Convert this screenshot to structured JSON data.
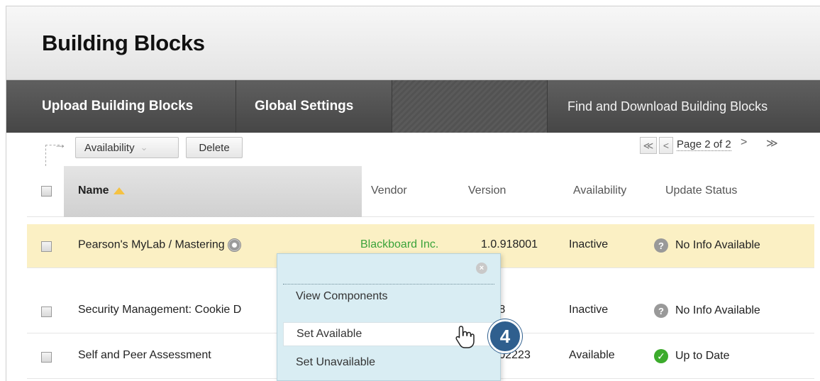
{
  "page": {
    "title": "Building Blocks"
  },
  "tabs": {
    "upload": "Upload Building Blocks",
    "global": "Global Settings",
    "find": "Find and Download Building Blocks"
  },
  "toolbar": {
    "availability_label": "Availability",
    "delete_label": "Delete"
  },
  "pager": {
    "first": "≪",
    "prev": "<",
    "text": "Page 2 of 2",
    "next": ">",
    "last": "≫"
  },
  "table": {
    "headers": {
      "name": "Name",
      "vendor": "Vendor",
      "version": "Version",
      "availability": "Availability",
      "update_status": "Update Status"
    },
    "rows": [
      {
        "name": "Pearson's MyLab / Mastering",
        "vendor": "Blackboard Inc.",
        "version": "1.0.918001",
        "availability": "Inactive",
        "status": "No Info Available",
        "status_icon": "question-icon"
      },
      {
        "name": "Security Management: Cookie D",
        "vendor": "",
        "version": "1.8",
        "availability": "Inactive",
        "status": "No Info Available",
        "status_icon": "question-icon"
      },
      {
        "name": "Self and Peer Assessment",
        "vendor": "",
        "version": "2.02223",
        "availability": "Available",
        "status": "Up to Date",
        "status_icon": "check-icon"
      }
    ]
  },
  "context_menu": {
    "items": [
      "View Components",
      "Set Available",
      "Set Unavailable"
    ],
    "hovered": "Set Available"
  },
  "step_badge": "4",
  "colors": {
    "highlight_row": "#fbf0c4",
    "menu_bg": "#d9edf3",
    "badge": "#2f5f8e",
    "vendor_link": "#3aa33a",
    "ok": "#3cab2c"
  }
}
